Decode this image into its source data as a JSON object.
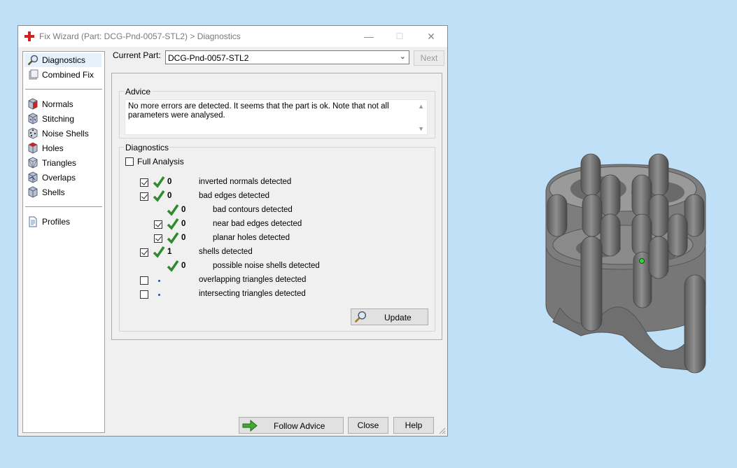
{
  "window": {
    "title": "Fix Wizard (Part: DCG-Pnd-0057-STL2) > Diagnostics",
    "controls": {
      "minimize": "—",
      "maximize": "☐",
      "close": "✕"
    }
  },
  "sidebar": {
    "items": [
      {
        "label": "Diagnostics",
        "icon": "magnifier-icon",
        "selected": true
      },
      {
        "label": "Combined Fix",
        "icon": "combined-fix-icon"
      },
      {
        "label": "Normals",
        "icon": "normals-cube-icon"
      },
      {
        "label": "Stitching",
        "icon": "stitching-cube-icon"
      },
      {
        "label": "Noise Shells",
        "icon": "noise-shells-cube-icon"
      },
      {
        "label": "Holes",
        "icon": "holes-cube-icon"
      },
      {
        "label": "Triangles",
        "icon": "triangles-cube-icon"
      },
      {
        "label": "Overlaps",
        "icon": "overlaps-cube-icon"
      },
      {
        "label": "Shells",
        "icon": "shells-cube-icon"
      },
      {
        "label": "Profiles",
        "icon": "profiles-document-icon"
      }
    ]
  },
  "header": {
    "current_part_label": "Current Part:",
    "current_part_value": "DCG-Pnd-0057-STL2",
    "next_label": "Next"
  },
  "advice": {
    "title": "Advice",
    "text": "No more errors are detected. It seems that the part is ok. Note that not all parameters were analysed."
  },
  "diagnostics": {
    "title": "Diagnostics",
    "full_analysis_label": "Full Analysis",
    "rows": [
      {
        "checked": true,
        "count": "0",
        "label": "inverted normals detected"
      },
      {
        "checked": true,
        "count": "0",
        "label": "bad edges detected"
      },
      {
        "checked": null,
        "count": "0",
        "label": "bad contours detected"
      },
      {
        "checked": true,
        "count": "0",
        "label": "near bad edges detected"
      },
      {
        "checked": true,
        "count": "0",
        "label": "planar holes detected"
      },
      {
        "checked": true,
        "count": "1",
        "label": "shells detected"
      },
      {
        "checked": null,
        "count": "0",
        "label": "possible noise shells detected"
      },
      {
        "checked": false,
        "count": "",
        "label": "overlapping triangles detected"
      },
      {
        "checked": false,
        "count": "",
        "label": "intersecting triangles detected"
      }
    ],
    "update_label": "Update"
  },
  "footer": {
    "follow_advice_label": "Follow Advice",
    "close_label": "Close",
    "help_label": "Help"
  },
  "colors": {
    "desktop": "#bfe0f7",
    "tick_green": "#2e8b2e",
    "window_bg": "#f0f0f0"
  }
}
